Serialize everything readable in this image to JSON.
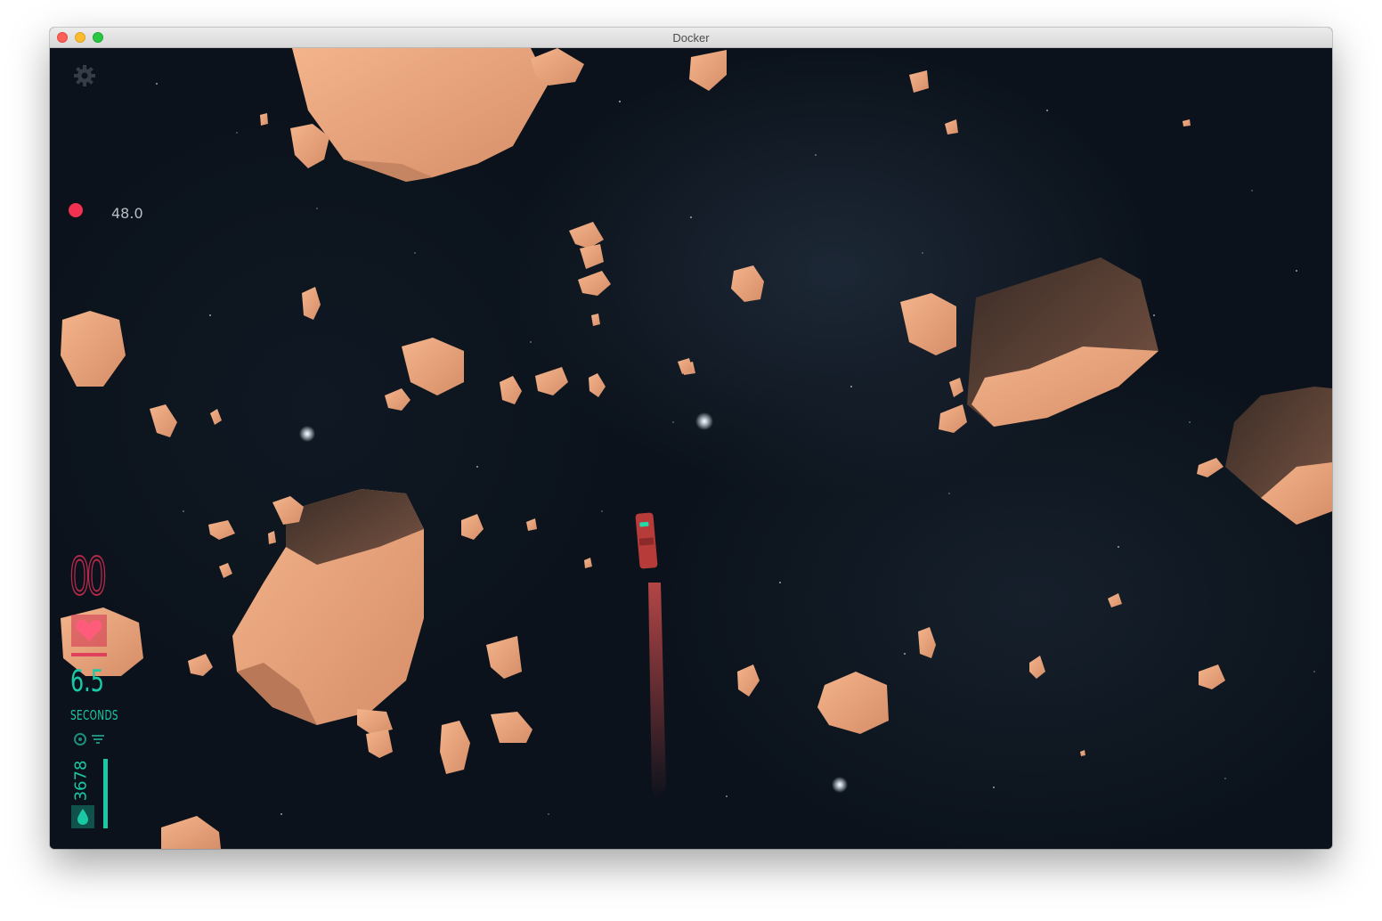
{
  "window": {
    "title": "Docker"
  },
  "hud": {
    "settings_icon": "gear-icon",
    "record_indicator_color": "#f0314f",
    "record_value": "48.0",
    "hull_counter": "00",
    "health_icon": "heart-icon",
    "health_level": 1.0,
    "timer_value": "6.5",
    "timer_label": "SECONDS",
    "status_icons": [
      "target-icon",
      "filter-icon"
    ],
    "fuel_value": "3678",
    "fuel_icon": "droplet-icon",
    "fuel_level": 1.0,
    "colors": {
      "danger": "#e0405e",
      "accent": "#19c9a5",
      "asteroid": "#e8a07a"
    }
  }
}
